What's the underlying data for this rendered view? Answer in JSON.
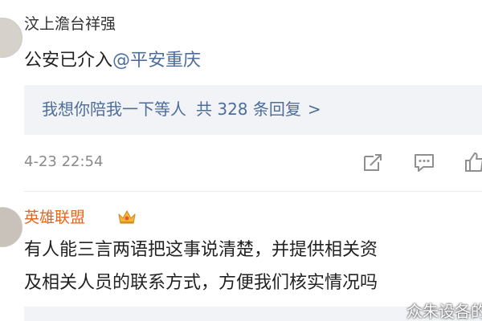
{
  "comments": [
    {
      "username": "汶上澹台祥强",
      "text": "公安已介入",
      "mention": "@平安重庆",
      "reply_preview": "我想你陪我一下等人",
      "reply_count": "共 328 条回复",
      "reply_arrow": ">",
      "timestamp": "4-23 22:54",
      "actions": [
        "share-icon",
        "comment-icon",
        "like-icon"
      ]
    },
    {
      "username": "英雄联盟",
      "badge": "crown-icon",
      "text_line1": "有人能三言两语把这事说清楚，并提供相关资",
      "text_line2": "及相关人员的联系方式，方便我们核实情况吗"
    }
  ],
  "watermark": "众朱设各的",
  "colors": {
    "username_default": "#333333",
    "username_official": "#e8641b",
    "link": "#4d6d9a",
    "reply_box_bg": "#f2f3f6",
    "timestamp": "#8a8a8a"
  }
}
